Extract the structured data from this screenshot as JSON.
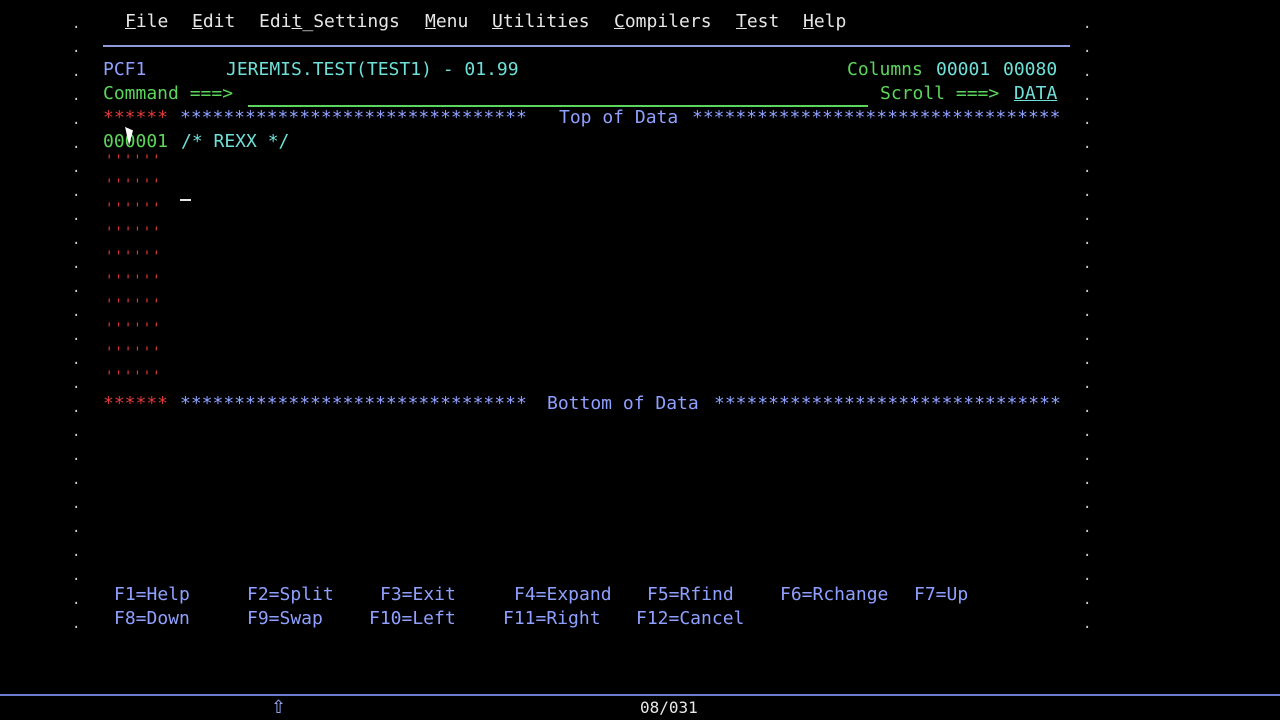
{
  "menu": {
    "file": {
      "ul": "F",
      "rest": "ile"
    },
    "edit": {
      "ul": "E",
      "rest": "dit"
    },
    "edit_settings": {
      "pre": "Edi",
      "ul": "t",
      "rest": "_Settings"
    },
    "menu": {
      "ul": "M",
      "rest": "enu"
    },
    "utilities": {
      "ul": "U",
      "rest": "tilities"
    },
    "compilers": {
      "ul": "C",
      "rest": "ompilers"
    },
    "test": {
      "ul": "T",
      "rest": "est"
    },
    "help": {
      "ul": "H",
      "rest": "elp"
    }
  },
  "header": {
    "panel_id": "PCF1",
    "dataset": "JEREMIS.TEST(TEST1) - 01.99",
    "columns_label": "Columns",
    "columns_from": "00001",
    "columns_to": "00080",
    "command_label": "Command ===>",
    "command_value": "",
    "scroll_label": "Scroll ===>",
    "scroll_value": "DATA"
  },
  "editor": {
    "top_marker": "******",
    "top_stars_left": "********************************",
    "top_text": "Top of Data",
    "top_stars_right": "**********************************",
    "line1_no": "000001",
    "line1_text": "/* REXX */",
    "empty_prefix": "''''''",
    "bottom_marker": "******",
    "bottom_stars_left": "********************************",
    "bottom_text": "Bottom of Data",
    "bottom_stars_right": "********************************"
  },
  "fkeys": {
    "row1": [
      "F1=Help",
      "F2=Split",
      "F3=Exit",
      "F4=Expand",
      "F5=Rfind",
      "F6=Rchange",
      "F7=Up"
    ],
    "row2": [
      "F8=Down",
      "F9=Swap",
      "F10=Left",
      "F11=Right",
      "F12=Cancel"
    ]
  },
  "status": {
    "arrow": "⇧",
    "position": "08/031"
  },
  "colors": {
    "background": "#000000",
    "green": "#5bd65b",
    "cyan": "#6fe0d8",
    "blue": "#8fa0ff",
    "red": "#e03a3a"
  }
}
